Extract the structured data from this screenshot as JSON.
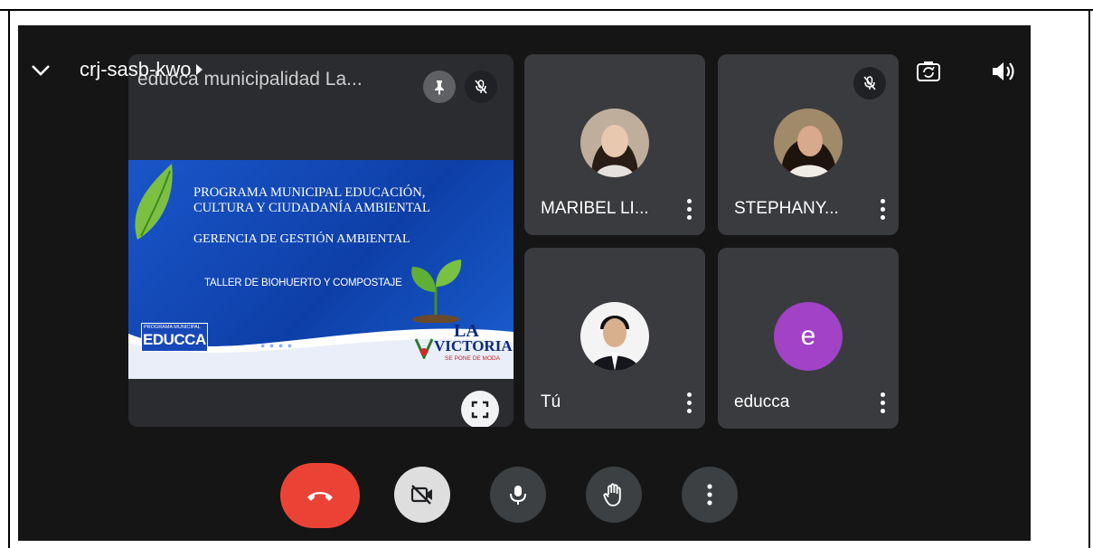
{
  "meeting": {
    "code": "crj-sasb-kwo"
  },
  "presenter": {
    "name": "educca municipalidad La...",
    "slide": {
      "line1": "PROGRAMA MUNICIPAL EDUCACIÓN,",
      "line2": "CULTURA Y CIUDADANÍA AMBIENTAL",
      "line3": "GERENCIA DE GESTIÓN AMBIENTAL",
      "line4": "TALLER DE BIOHUERTO Y COMPOSTAJE",
      "logo_small": "PROGRAMA MUNICIPAL",
      "logo_big": "EDUCCA",
      "victoria_la": "LA",
      "victoria_name": "VICTORIA",
      "victoria_sub": "SE PONE DE MODA"
    }
  },
  "participants": [
    {
      "name": "MARIBEL LI...",
      "muted": false
    },
    {
      "name": "STEPHANY...",
      "muted": true
    },
    {
      "name": "Tú",
      "muted": false
    },
    {
      "name": "educca",
      "initial": "e",
      "avatar_color": "#a142c7"
    }
  ],
  "colors": {
    "end_call": "#ea4335",
    "tile_bg": "#3a3b3e",
    "screen_bg": "#151515"
  }
}
